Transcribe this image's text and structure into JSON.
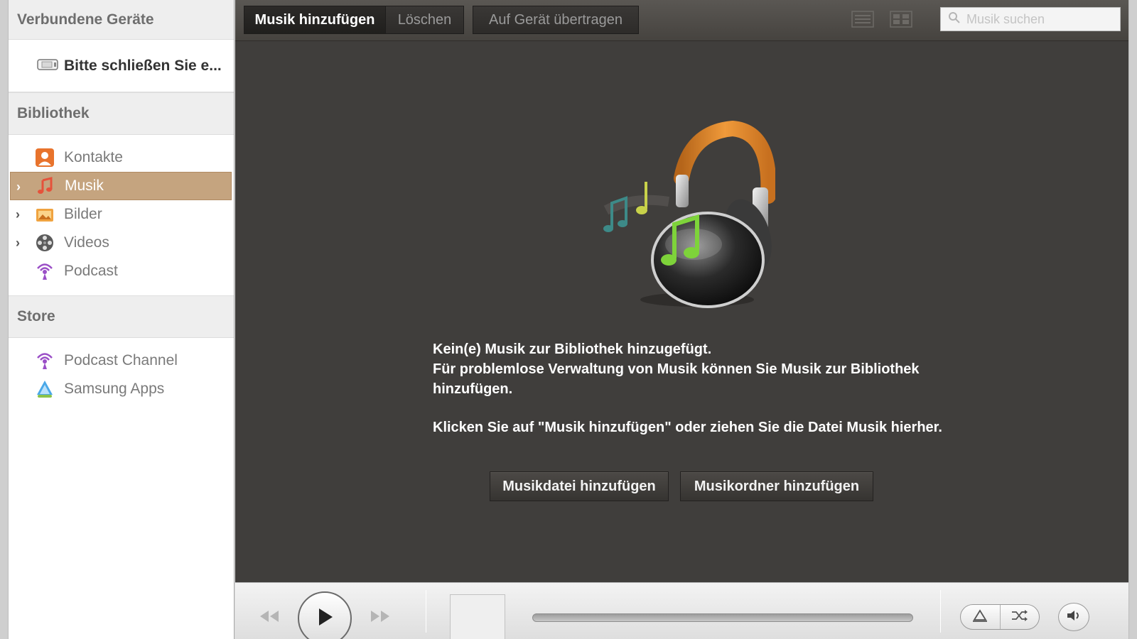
{
  "sidebar": {
    "connected_header": "Verbundene Geräte",
    "device_label": "Bitte schließen Sie e...",
    "library_header": "Bibliothek",
    "library_items": [
      {
        "label": "Kontakte",
        "icon": "contacts-icon"
      },
      {
        "label": "Musik",
        "icon": "music-icon",
        "selected": true
      },
      {
        "label": "Bilder",
        "icon": "pictures-icon"
      },
      {
        "label": "Videos",
        "icon": "videos-icon"
      },
      {
        "label": "Podcast",
        "icon": "podcast-icon"
      }
    ],
    "store_header": "Store",
    "store_items": [
      {
        "label": "Podcast Channel",
        "icon": "podcast-channel-icon"
      },
      {
        "label": "Samsung Apps",
        "icon": "samsung-apps-icon"
      }
    ]
  },
  "toolbar": {
    "add_music": "Musik hinzufügen",
    "delete": "Löschen",
    "transfer": "Auf Gerät übertragen",
    "search_placeholder": "Musik suchen"
  },
  "empty_state": {
    "line1": "Kein(e) Musik zur Bibliothek hinzugefügt.",
    "line2": "Für problemlose Verwaltung von Musik können Sie Musik zur Bibliothek hinzufügen.",
    "line3": "Klicken Sie auf \"Musik hinzufügen\" oder ziehen Sie die Datei Musik hierher.",
    "add_file_button": "Musikdatei hinzufügen",
    "add_folder_button": "Musikordner hinzufügen"
  },
  "player": {
    "progress": 0
  },
  "colors": {
    "selected_item": "#c5a47f",
    "main_background": "#403e3c",
    "headphone_band": "#e08a2c",
    "note_green": "#7ed33a"
  }
}
